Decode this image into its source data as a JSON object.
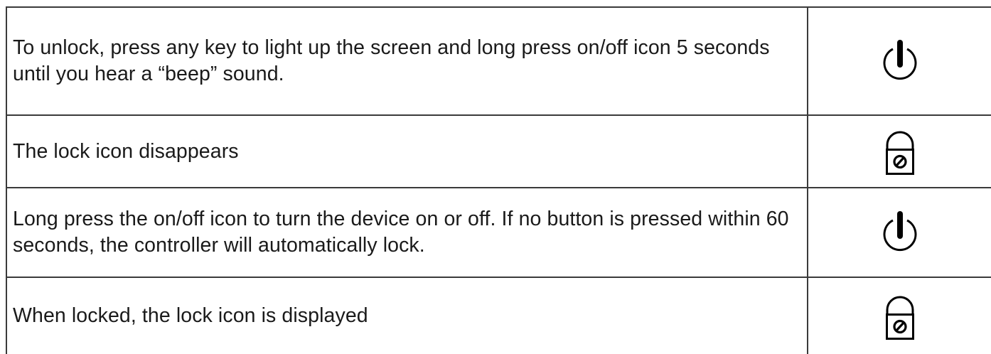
{
  "rows": [
    {
      "text": "To unlock, press any key to light up the screen and long press on/off icon 5 seconds until you hear a “beep” sound.",
      "icon": "power-icon"
    },
    {
      "text": "The lock icon disappears",
      "icon": "lock-icon"
    },
    {
      "text": "Long press the on/off icon to turn the device on or off. If no button is pressed within 60 seconds, the controller will automatically lock.",
      "icon": "power-icon"
    },
    {
      "text": "When locked, the lock icon is displayed",
      "icon": "lock-icon"
    }
  ]
}
